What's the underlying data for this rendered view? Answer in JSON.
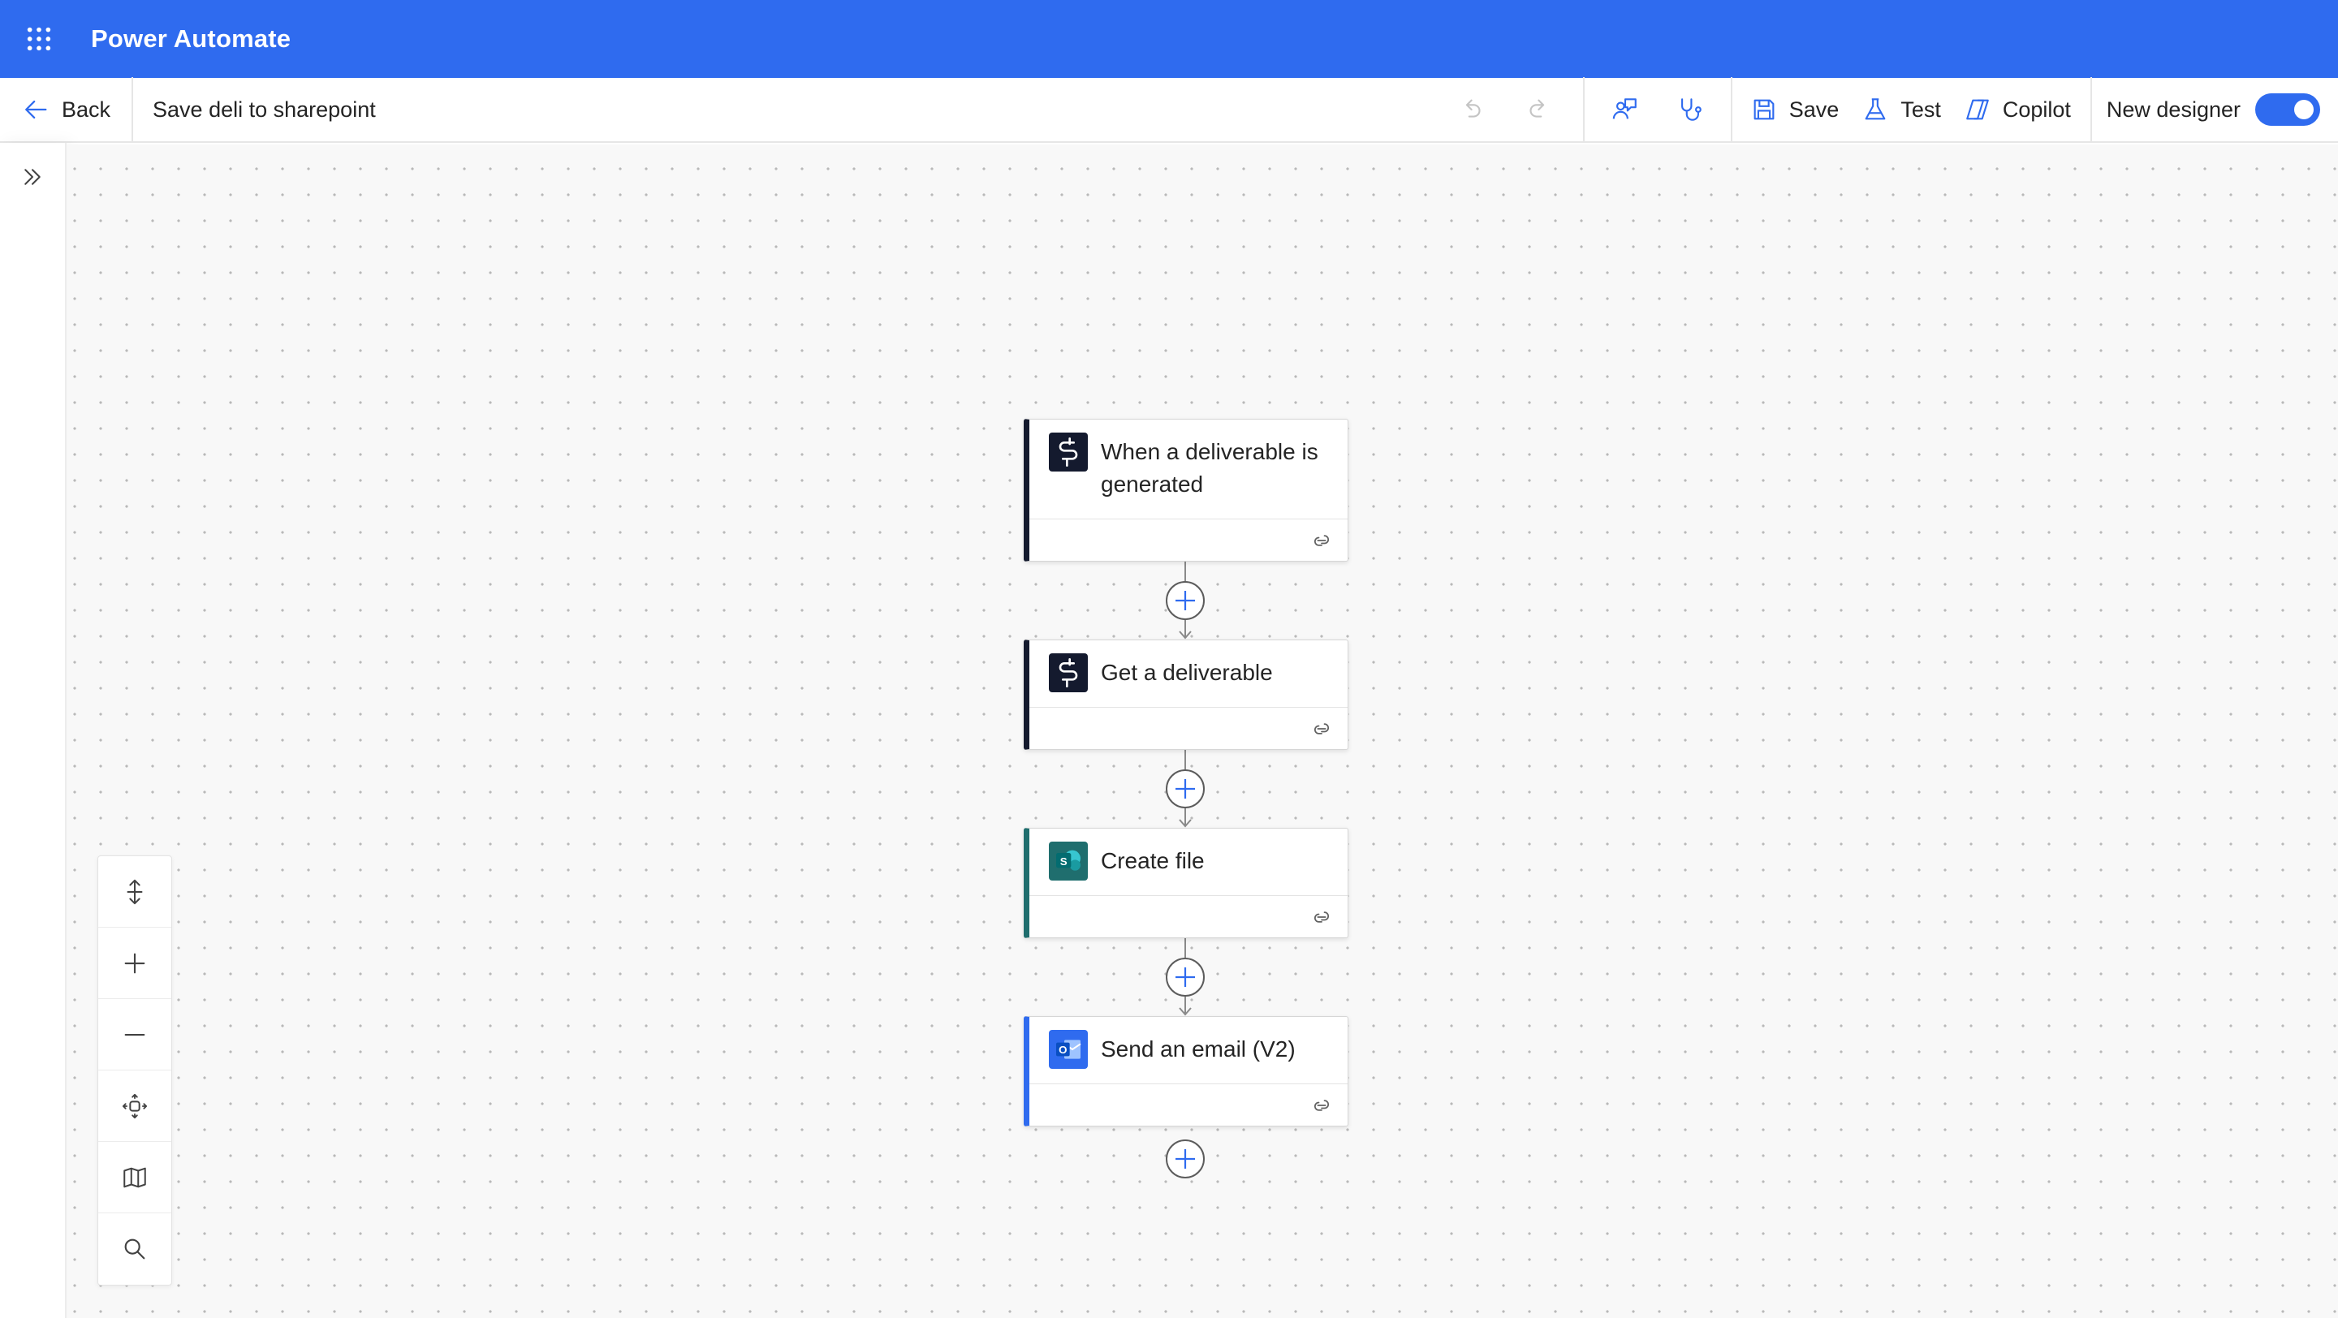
{
  "app": {
    "title": "Power Automate",
    "accent_color": "#2f6bef"
  },
  "commandbar": {
    "back_label": "Back",
    "flow_name": "Save deli to sharepoint",
    "save_label": "Save",
    "test_label": "Test",
    "copilot_label": "Copilot",
    "new_designer_label": "New designer",
    "new_designer_enabled": true
  },
  "flow": {
    "steps": [
      {
        "title": "When a deliverable is generated",
        "icon": "deliverable-connector-icon",
        "accent": "#141a2e"
      },
      {
        "title": "Get a deliverable",
        "icon": "deliverable-connector-icon",
        "accent": "#141a2e"
      },
      {
        "title": "Create file",
        "icon": "sharepoint-icon",
        "accent": "#1f6e6e"
      },
      {
        "title": "Send an email (V2)",
        "icon": "outlook-icon",
        "accent": "#2f6bef"
      }
    ]
  },
  "icons": {
    "waffle": "app-launcher-icon",
    "back": "arrow-left-icon",
    "undo": "undo-icon",
    "redo": "redo-icon",
    "feedback": "feedback-icon",
    "flow_checker": "stethoscope-icon",
    "save": "save-icon",
    "test": "beaker-icon",
    "copilot": "copilot-icon",
    "link": "link-icon",
    "add": "plus-circle-icon",
    "expand": "chevron-double-right-icon",
    "fit": "fit-vertical-icon",
    "zoom_in": "zoom-in-icon",
    "zoom_out": "zoom-out-icon",
    "center": "center-view-icon",
    "minimap": "map-icon",
    "search": "search-icon"
  }
}
